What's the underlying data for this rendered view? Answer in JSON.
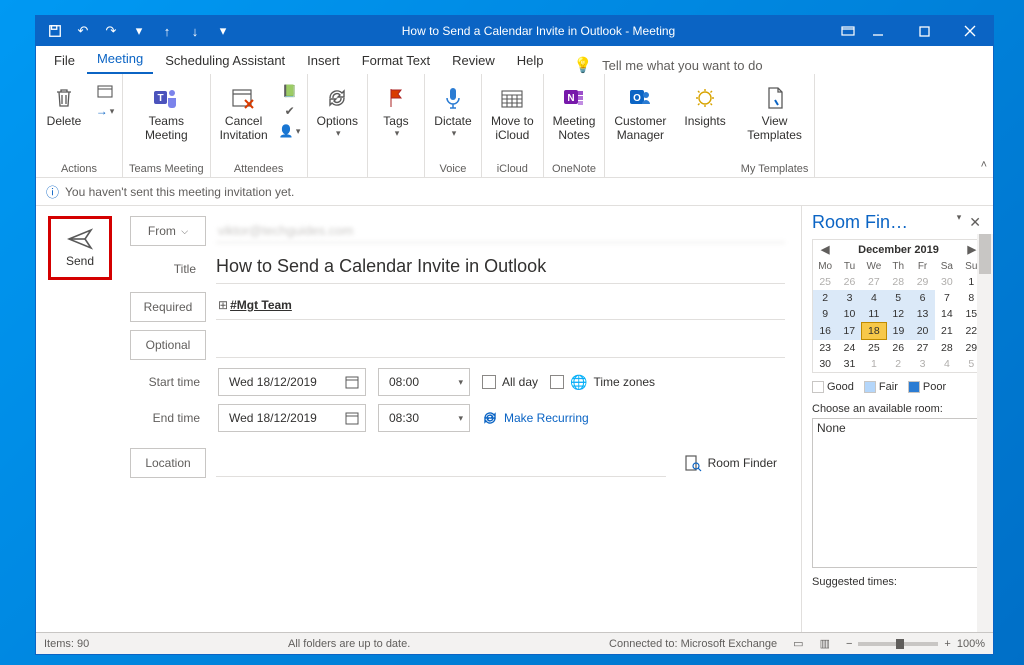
{
  "titlebar": {
    "title": "How to Send a Calendar Invite in Outlook  -  Meeting"
  },
  "menu": {
    "file": "File",
    "meeting": "Meeting",
    "scheduling": "Scheduling Assistant",
    "insert": "Insert",
    "format": "Format Text",
    "review": "Review",
    "help": "Help",
    "tellme": "Tell me what you want to do"
  },
  "ribbon": {
    "delete": "Delete",
    "actions_group": "Actions",
    "teams_meeting": "Teams\nMeeting",
    "teams_group": "Teams Meeting",
    "cancel_invitation": "Cancel\nInvitation",
    "attendees_group": "Attendees",
    "options": "Options",
    "tags": "Tags",
    "dictate": "Dictate",
    "voice_group": "Voice",
    "move_icloud": "Move to\niCloud",
    "icloud_group": "iCloud",
    "meeting_notes": "Meeting\nNotes",
    "onenote_group": "OneNote",
    "customer_manager": "Customer\nManager",
    "insights": "Insights",
    "view_templates": "View\nTemplates",
    "templates_group": "My Templates"
  },
  "info": "You haven't sent this meeting invitation yet.",
  "send": "Send",
  "fields": {
    "from_label": "From",
    "from_value": "viktor@techguides.com",
    "title_label": "Title",
    "title_value": "How to Send a Calendar Invite in Outlook",
    "required_label": "Required",
    "required_value": "#Mgt Team",
    "optional_label": "Optional",
    "start_label": "Start time",
    "end_label": "End time",
    "start_date": "Wed 18/12/2019",
    "start_time": "08:00",
    "end_date": "Wed 18/12/2019",
    "end_time": "08:30",
    "all_day": "All day",
    "time_zones": "Time zones",
    "recurring": "Make Recurring",
    "location_label": "Location",
    "room_finder": "Room Finder"
  },
  "room_panel": {
    "title": "Room Fin…",
    "month": "December 2019",
    "weekdays": [
      "Mo",
      "Tu",
      "We",
      "Th",
      "Fr",
      "Sa",
      "Su"
    ],
    "legend_good": "Good",
    "legend_fair": "Fair",
    "legend_poor": "Poor",
    "choose_label": "Choose an available room:",
    "room_none": "None",
    "suggested_label": "Suggested times:",
    "grid": [
      [
        {
          "d": 25,
          "dim": true
        },
        {
          "d": 26,
          "dim": true
        },
        {
          "d": 27,
          "dim": true
        },
        {
          "d": 28,
          "dim": true
        },
        {
          "d": 29,
          "dim": true
        },
        {
          "d": 30,
          "dim": true
        },
        {
          "d": 1
        }
      ],
      [
        {
          "d": 2,
          "busy": true
        },
        {
          "d": 3,
          "busy": true
        },
        {
          "d": 4,
          "busy": true
        },
        {
          "d": 5,
          "busy": true
        },
        {
          "d": 6,
          "busy": true
        },
        {
          "d": 7
        },
        {
          "d": 8
        }
      ],
      [
        {
          "d": 9,
          "busy": true
        },
        {
          "d": 10,
          "busy": true
        },
        {
          "d": 11,
          "busy": true
        },
        {
          "d": 12,
          "busy": true
        },
        {
          "d": 13,
          "busy": true
        },
        {
          "d": 14
        },
        {
          "d": 15
        }
      ],
      [
        {
          "d": 16,
          "busy": true
        },
        {
          "d": 17,
          "busy": true
        },
        {
          "d": 18,
          "sel": true
        },
        {
          "d": 19,
          "busy": true
        },
        {
          "d": 20,
          "busy": true
        },
        {
          "d": 21
        },
        {
          "d": 22
        }
      ],
      [
        {
          "d": 23
        },
        {
          "d": 24
        },
        {
          "d": 25
        },
        {
          "d": 26
        },
        {
          "d": 27
        },
        {
          "d": 28
        },
        {
          "d": 29
        }
      ],
      [
        {
          "d": 30
        },
        {
          "d": 31
        },
        {
          "d": 1,
          "dim": true
        },
        {
          "d": 2,
          "dim": true
        },
        {
          "d": 3,
          "dim": true
        },
        {
          "d": 4,
          "dim": true
        },
        {
          "d": 5,
          "dim": true
        }
      ]
    ]
  },
  "statusbar": {
    "items": "Items: 90",
    "sync": "All folders are up to date.",
    "conn": "Connected to: Microsoft Exchange",
    "zoom": "100%"
  }
}
